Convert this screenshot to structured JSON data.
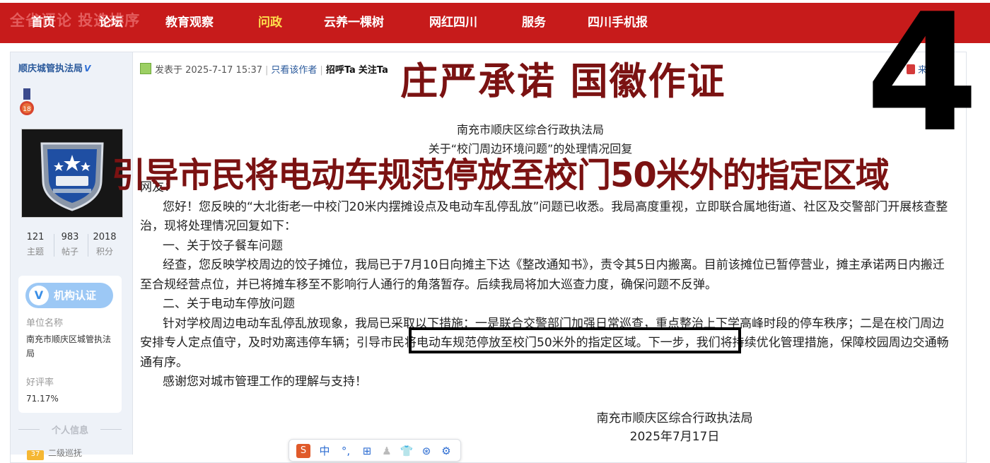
{
  "nav": {
    "ghost_text": "全省评论 投选排序",
    "items": [
      "首页",
      "论坛",
      "教育观察",
      "问政",
      "云养一棵树",
      "网红四川",
      "服务",
      "四川手机报"
    ],
    "active_item": "问政"
  },
  "author": {
    "name": "顺庆城管执法局",
    "verified_mark": "V",
    "medal_number": "18",
    "stats": [
      {
        "value": "121",
        "label": "主题"
      },
      {
        "value": "983",
        "label": "帖子"
      },
      {
        "value": "2018",
        "label": "积分"
      }
    ],
    "cert_badge": "V",
    "cert_label": "机构认证",
    "unit_label": "单位名称",
    "unit_value": "南充市顺庆区城管执法局",
    "rating_label": "好评率",
    "rating_value": "71.17%",
    "section_title": "个人信息",
    "level_badge": "37",
    "level_text": "二级巡抚"
  },
  "post": {
    "posted_at": "发表于 2025-7-17 15:37",
    "only_author": "只看该作者",
    "greet": "招呼Ta",
    "follow": "关注Ta",
    "floor": "来自 2#",
    "org": "南充市顺庆区综合行政执法局",
    "subject": "关于“校门周边环境问题”的处理情况回复",
    "salutation": "网友：",
    "paragraphs": [
      "您好！您反映的“大北街老一中校门20米内摆摊设点及电动车乱停乱放”问题已收悉。我局高度重视，立即联合属地街道、社区及交警部门开展核查整治，现将处理情况回复如下：",
      "一、关于饺子餐车问题",
      "经查，您反映学校周边的饺子摊位，我局已于7月10日向摊主下达《整改通知书》，责令其5日内搬离。目前该摊位已暂停营业，摊主承诺两日内搬迁至合规经营点位，并已将摊车移至不影响行人通行的角落暂存。后续我局将加大巡查力度，确保问题不反弹。",
      "二、关于电动车停放问题",
      "针对学校周边电动车乱停乱放现象，我局已采取以下措施：一是联合交警部门加强日常巡查，重点整治上下学高峰时段的停车秩序；二是在校门周边安排专人定点值守，及时劝离违停车辆；引导市民将电动车规范停放至校门50米外的指定区域。下一步，我们将持续优化管理措施，保障校园周边交通畅通有序。",
      "感谢您对城市管理工作的理解与支持！"
    ],
    "signature_org": "南充市顺庆区综合行政执法局",
    "signature_date": "2025年7月17日"
  },
  "overlay": {
    "title": "庄严承诺 国徽作证",
    "number": "4",
    "headline": "引导市民将电动车规范停放至校门50米外的指定区域"
  },
  "toolbar": {
    "buttons": [
      "S",
      "中",
      "°,",
      "⊞",
      "♟",
      "👕",
      "⊛",
      "⚙"
    ]
  },
  "colors": {
    "nav_bg": "#c71b1b",
    "nav_active": "#ffe14d",
    "overlay_red": "#7b1212",
    "link_blue": "#2b5a9c",
    "sidebar_bg": "#eef2f8"
  }
}
